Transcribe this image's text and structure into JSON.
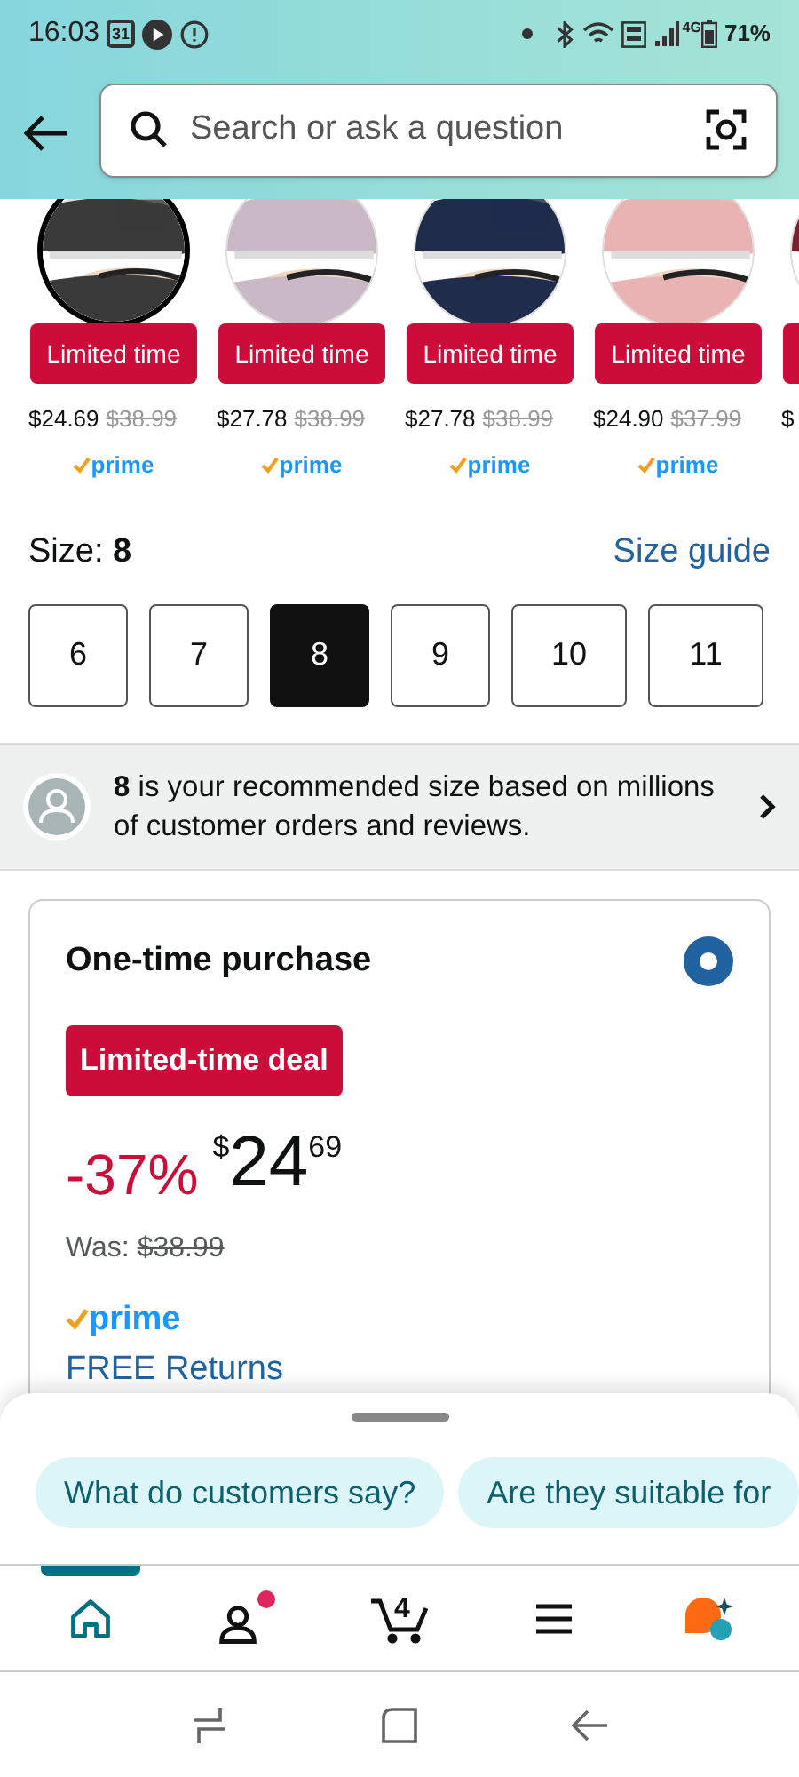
{
  "status_bar": {
    "time": "16:03",
    "battery": "71%",
    "calendar_day": "31",
    "network": "4G"
  },
  "search": {
    "placeholder": "Search or ask a question"
  },
  "variants": [
    {
      "selected": true,
      "color": "#3a3a3a",
      "badge": "Limited time",
      "price": "$24.69",
      "list_price": "$38.99",
      "prime": "prime"
    },
    {
      "selected": false,
      "color": "#c9b8c6",
      "badge": "Limited time",
      "price": "$27.78",
      "list_price": "$38.99",
      "prime": "prime"
    },
    {
      "selected": false,
      "color": "#1f2c4c",
      "badge": "Limited time",
      "price": "$27.78",
      "list_price": "$38.99",
      "prime": "prime"
    },
    {
      "selected": false,
      "color": "#eab3b3",
      "badge": "Limited time",
      "price": "$24.90",
      "list_price": "$37.99",
      "prime": "prime"
    },
    {
      "selected": false,
      "color": "#7a1f2c",
      "price": "$"
    }
  ],
  "size": {
    "label": "Size:",
    "value": "8",
    "guide": "Size guide",
    "options": [
      {
        "label": "6",
        "selected": false
      },
      {
        "label": "7",
        "selected": false
      },
      {
        "label": "8",
        "selected": true
      },
      {
        "label": "9",
        "selected": false
      },
      {
        "label": "10",
        "selected": false
      },
      {
        "label": "11",
        "selected": false
      }
    ]
  },
  "recommendation": {
    "text": "**8** is your recommended size based on millions of customer orders and reviews."
  },
  "purchase": {
    "title": "One-time purchase",
    "selected": true,
    "deal_badge": "Limited-time deal",
    "discount": "-37%",
    "currency": "$",
    "price_whole": "24",
    "price_fraction": "69",
    "was_label": "Was:",
    "was_price": "$38.99",
    "prime": "prime",
    "returns": "FREE Returns"
  },
  "chips": [
    "What do customers say?",
    "Are they suitable for"
  ],
  "nav": [
    {
      "kind": "home",
      "selected": true
    },
    {
      "kind": "account",
      "selected": false,
      "dot": true
    },
    {
      "kind": "cart",
      "selected": false,
      "count": "4"
    },
    {
      "kind": "menu",
      "selected": false
    },
    {
      "kind": "assistant",
      "selected": false
    }
  ]
}
